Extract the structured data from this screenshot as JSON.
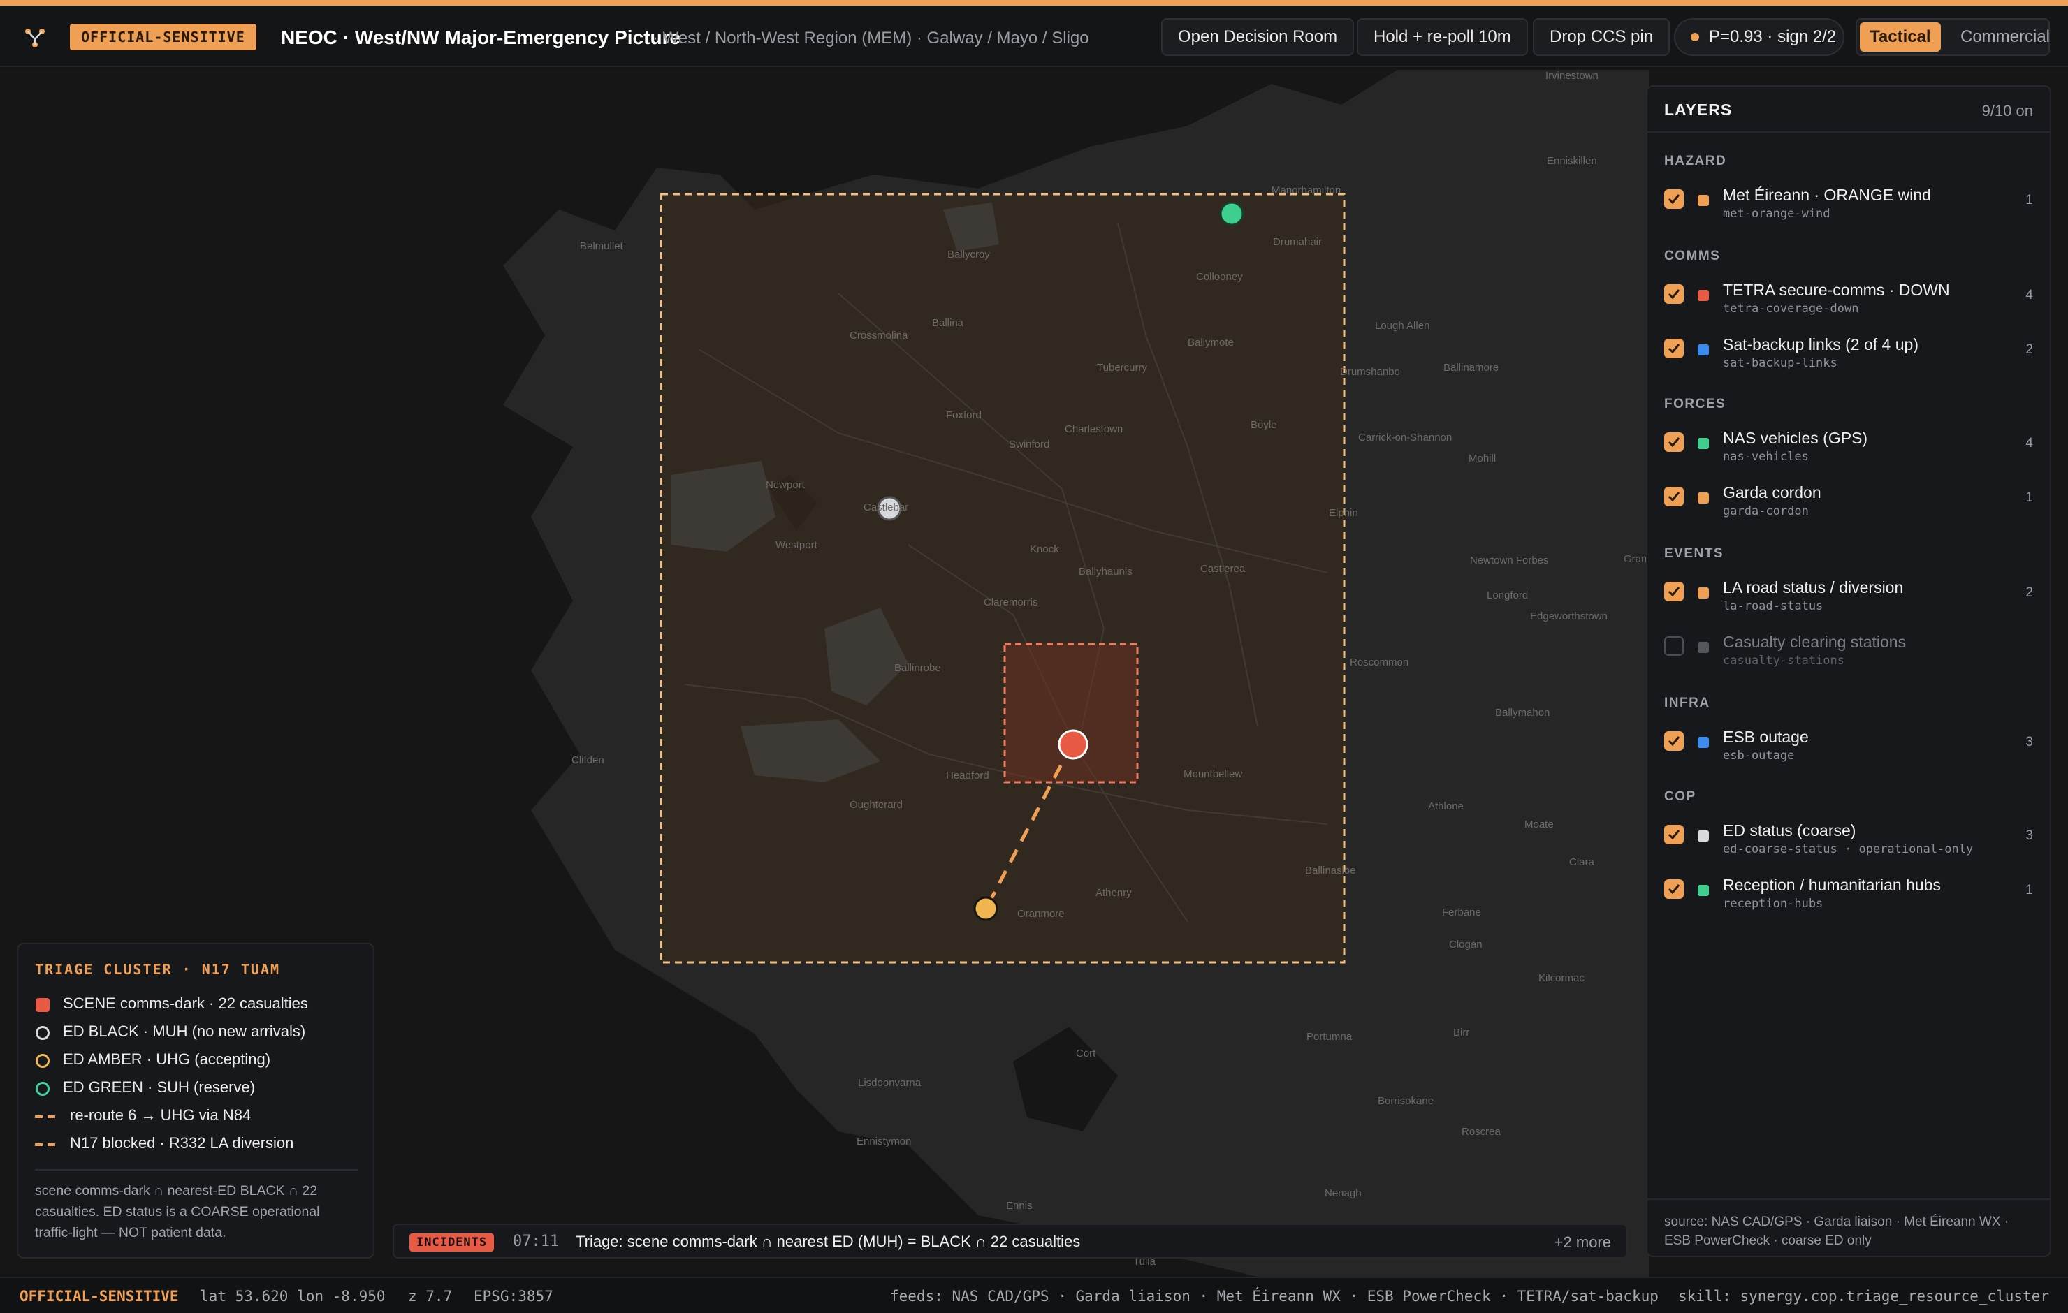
{
  "header": {
    "classification": "OFFICIAL-SENSITIVE",
    "title": "NEOC · West/NW Major-Emergency Picture",
    "subtitle": "· West / North-West Region (MEM) · Galway / Mayo / Sligo",
    "buttons": {
      "decision_room": "Open Decision Room",
      "hold_repoll": "Hold + re-poll 10m",
      "drop_pin": "Drop CCS pin"
    },
    "status": "P=0.93 · sign 2/2",
    "modes": {
      "active": "Tactical",
      "inactive": "Commercial"
    },
    "colors": {
      "accent": "#f0a055",
      "scene": "#e85a44"
    }
  },
  "map": {
    "place_labels": [
      "Irvinestown",
      "Enniskillen",
      "Manorhamilton",
      "Drumahair",
      "Collooney",
      "Belmullet",
      "Ballycroy",
      "Crossmolina",
      "Ballina",
      "Ballymote",
      "Tubercurry",
      "Lough Allen",
      "Drumshanbo",
      "Ballinamore",
      "Foxford",
      "Charlestown",
      "Swinford",
      "Boyle",
      "Carrick-on-Shannon",
      "Mohill",
      "Newport",
      "Castlebar",
      "Westport",
      "Knock",
      "Ballyhaunis",
      "Castlerea",
      "Elphin",
      "Newtown Forbes",
      "Longford",
      "Edgeworthstown",
      "Claremorris",
      "Ballinrobe",
      "Roscommon",
      "Ballymahon",
      "Clifden",
      "Headford",
      "Mountbellew",
      "Oughterard",
      "Athlone",
      "Moate",
      "Athenry",
      "Oranmore",
      "Ballinasloe",
      "Clara",
      "Ferbane",
      "Clogan",
      "Kilcormac",
      "Cort",
      "Portumna",
      "Birr",
      "Lisdoonvarna",
      "Borrisokane",
      "Ennistymon",
      "Nenagh",
      "Ennis",
      "Roscrea",
      "Tulla",
      "Granard"
    ],
    "markers": {
      "scene": "scene-marker",
      "ed_black": "ed-black-marker",
      "ed_amber": "ed-amber-marker",
      "ed_green": "ed-green-marker"
    }
  },
  "layers": {
    "title": "LAYERS",
    "count": "9/10 on",
    "groups": {
      "hazard": "HAZARD",
      "comms": "COMMS",
      "forces": "FORCES",
      "events": "EVENTS",
      "infra": "INFRA",
      "cop": "COP"
    },
    "items": [
      {
        "name": "Met Éireann · ORANGE wind",
        "id": "met-orange-wind",
        "count": "1",
        "checked": true,
        "color": "#f0a055"
      },
      {
        "name": "TETRA secure-comms · DOWN",
        "id": "tetra-coverage-down",
        "count": "4",
        "checked": true,
        "color": "#e85a44"
      },
      {
        "name": "Sat-backup links (2 of 4 up)",
        "id": "sat-backup-links",
        "count": "2",
        "checked": true,
        "color": "#3b8cf0"
      },
      {
        "name": "NAS vehicles (GPS)",
        "id": "nas-vehicles",
        "count": "4",
        "checked": true,
        "color": "#3ecf8e"
      },
      {
        "name": "Garda cordon",
        "id": "garda-cordon",
        "count": "1",
        "checked": true,
        "color": "#f0a055"
      },
      {
        "name": "LA road status / diversion",
        "id": "la-road-status",
        "count": "2",
        "checked": true,
        "color": "#f0a055"
      },
      {
        "name": "Casualty clearing stations",
        "id": "casualty-stations",
        "count": "",
        "checked": false,
        "color": "#55575d"
      },
      {
        "name": "ESB outage",
        "id": "esb-outage",
        "count": "3",
        "checked": true,
        "color": "#3b8cf0"
      },
      {
        "name": "ED status (coarse)",
        "id": "ed-coarse-status · operational-only",
        "count": "3",
        "checked": true,
        "color": "#d8d9dc"
      },
      {
        "name": "Reception / humanitarian hubs",
        "id": "reception-hubs",
        "count": "1",
        "checked": true,
        "color": "#3ecf8e"
      }
    ],
    "footer": "source: NAS CAD/GPS · Garda liaison · Met Éireann WX · ESB PowerCheck · coarse ED only"
  },
  "triage": {
    "title": "TRIAGE CLUSTER · N17 TUAM",
    "legend": [
      {
        "label": "SCENE comms-dark · 22 casualties",
        "icon": "scene-square-icon",
        "color": "#e85a44"
      },
      {
        "label": "ED BLACK · MUH (no new arrivals)",
        "icon": "ed-black-ring-icon",
        "color": "#d8d9dc"
      },
      {
        "label": "ED AMBER · UHG (accepting)",
        "icon": "ed-amber-ring-icon",
        "color": "#f0b450"
      },
      {
        "label": "ED GREEN · SUH (reserve)",
        "icon": "ed-green-ring-icon",
        "color": "#3ecf9e"
      },
      {
        "label": "re-route 6 → UHG via N84",
        "icon": "reroute-dash-icon",
        "color": "#f0a055"
      },
      {
        "label": "N17 blocked · R332 LA diversion",
        "icon": "diversion-dash-icon",
        "color": "#f0a055"
      }
    ],
    "note": "scene comms-dark ∩ nearest-ED BLACK ∩ 22 casualties. ED status is a COARSE operational traffic-light — NOT patient data."
  },
  "incidents": {
    "badge": "INCIDENTS",
    "time": "07:11",
    "text": "Triage: scene comms-dark ∩ nearest ED (MUH) = BLACK ∩ 22 casualties",
    "more": "+2 more"
  },
  "statusbar": {
    "classification": "OFFICIAL-SENSITIVE",
    "coords": "lat 53.620 lon -8.950",
    "zoom": "z 7.7",
    "epsg": "EPSG:3857",
    "feeds": "feeds: NAS CAD/GPS · Garda liaison · Met Éireann WX · ESB PowerCheck · TETRA/sat-backup",
    "skill": "skill: synergy.cop.triage_resource_cluster"
  }
}
